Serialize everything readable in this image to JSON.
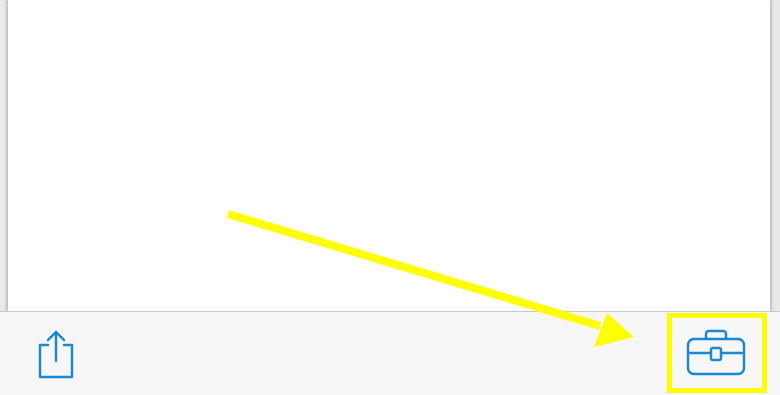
{
  "toolbar": {
    "buttons": [
      {
        "id": "share",
        "icon": "share-icon"
      },
      {
        "id": "tools",
        "icon": "toolbox-icon"
      }
    ]
  },
  "annotation": {
    "arrow_color": "#ffff00",
    "highlight_target": "tools"
  },
  "colors": {
    "icon": "#1a87d6",
    "highlight": "#ffff00",
    "toolbar_bg": "#f7f7f7",
    "page_bg": "#ffffff"
  }
}
